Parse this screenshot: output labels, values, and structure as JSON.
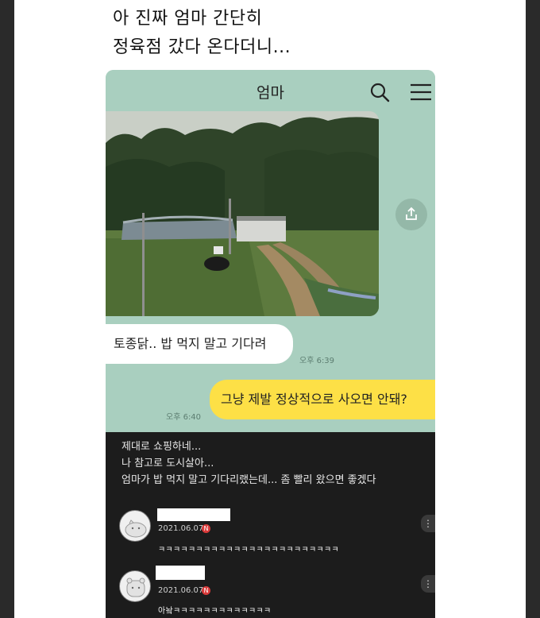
{
  "post": {
    "title_line1": "아 진짜 엄마 간단히",
    "title_line2": "정육점 갔다 온다더니..."
  },
  "chat": {
    "title": "엄마",
    "incoming_message": "토종닭.. 밥 먹지 말고 기다려",
    "incoming_time": "오후 6:39",
    "outgoing_message": "그냥 제발 정상적으로 사오면 안돼?",
    "outgoing_time": "오후 6:40",
    "colors": {
      "background": "#a9cfbf",
      "outgoing_bubble": "#fde046",
      "incoming_bubble": "#ffffff"
    }
  },
  "caption": {
    "line1": "제대로 쇼핑하네...",
    "line2": "나 참고로 도시살아...",
    "line3": "엄마가 밥 먹지 말고 기다리랬는데... 좀 빨리 왔으면 좋겠다"
  },
  "comments": [
    {
      "date": "2021.06.07",
      "badge": "N",
      "text": "ㅋㅋㅋㅋㅋㅋㅋㅋㅋㅋㅋㅋㅋㅋㅋㅋㅋㅋㅋㅋㅋㅋㅋㅋ"
    },
    {
      "date": "2021.06.07",
      "badge": "N",
      "text": "아놬ㅋㅋㅋㅋㅋㅋㅋㅋㅋㅋㅋㅋㅋ"
    }
  ],
  "icons": [
    "search-icon",
    "menu-icon",
    "share-icon",
    "avatar-icon",
    "more-icon"
  ]
}
